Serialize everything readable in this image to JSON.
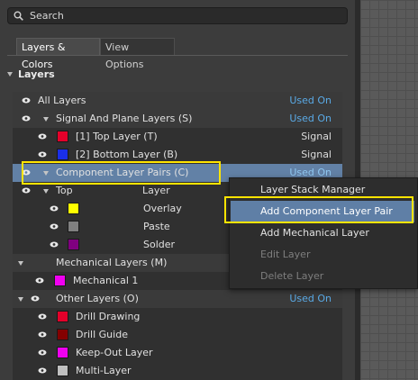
{
  "search": {
    "placeholder": "Search"
  },
  "tabs": [
    {
      "label": "Layers & Colors",
      "active": true
    },
    {
      "label": "View Options",
      "active": false
    }
  ],
  "section": {
    "title": "Layers"
  },
  "rows": [
    {
      "label": "All Layers",
      "right": "Used On"
    },
    {
      "label": "Signal And Plane Layers (S)",
      "right": "Used On"
    },
    {
      "label": "[1] Top Layer (T)",
      "color": "#e4002a",
      "right": "Signal"
    },
    {
      "label": "[2] Bottom Layer (B)",
      "color": "#1a2fe8",
      "right": "Signal"
    },
    {
      "label": "Component Layer Pairs (C)",
      "right": "Used On",
      "selected": true
    },
    {
      "label": "Top",
      "mid": "Layer"
    },
    {
      "label": "Overlay",
      "color": "#ffff00"
    },
    {
      "label": "Paste",
      "color": "#808080"
    },
    {
      "label": "Solder",
      "color": "#800080"
    },
    {
      "label": "Mechanical Layers (M)"
    },
    {
      "label": "Mechanical 1",
      "color": "#f000f0"
    },
    {
      "label": "Other Layers (O)",
      "right": "Used On"
    },
    {
      "label": "Drill Drawing",
      "color": "#e4002a"
    },
    {
      "label": "Drill Guide",
      "color": "#840000"
    },
    {
      "label": "Keep-Out Layer",
      "color": "#f000f0"
    },
    {
      "label": "Multi-Layer",
      "color": "#c0c0c0"
    }
  ],
  "context_menu": {
    "items": [
      {
        "label": "Layer Stack Manager",
        "enabled": true
      },
      {
        "label": "Add Component Layer Pair",
        "enabled": true,
        "highlighted": true
      },
      {
        "label": "Add Mechanical Layer",
        "enabled": true
      },
      {
        "label": "Edit Layer",
        "enabled": false
      },
      {
        "label": "Delete Layer",
        "enabled": false
      }
    ]
  },
  "colors": {
    "selection": "#6281a6",
    "link": "#5aaae6",
    "callout": "#ffe400"
  }
}
